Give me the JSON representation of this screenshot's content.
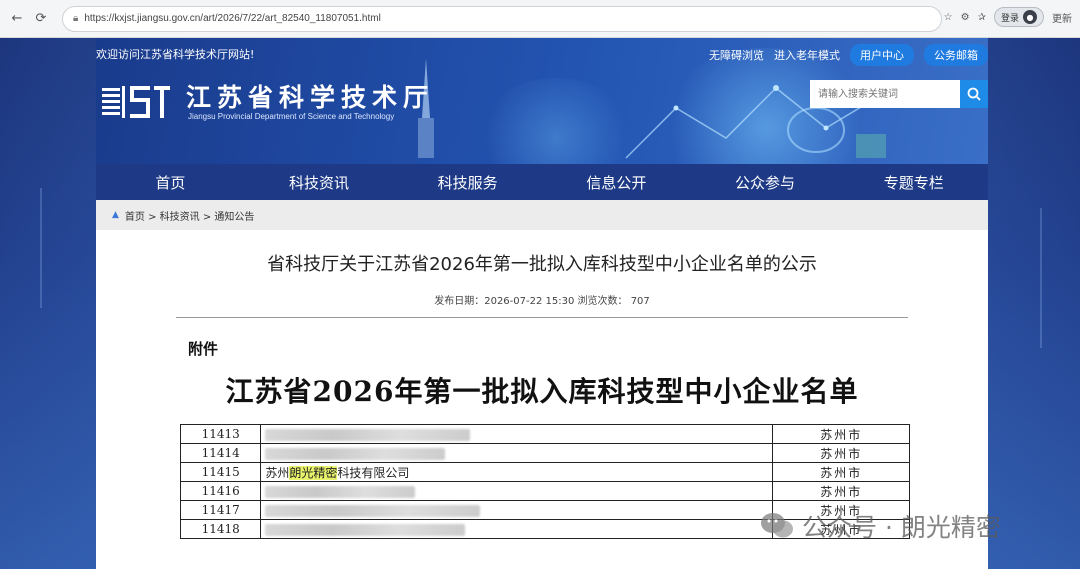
{
  "browser": {
    "url": "https://kxjst.jiangsu.gov.cn/art/2026/7/22/art_82540_11807051.html",
    "profile_label": "登录",
    "update_label": "更新"
  },
  "site": {
    "welcome": "欢迎访问江苏省科学技术厅网站!",
    "top_links": [
      "无障碍浏览",
      "进入老年模式"
    ],
    "top_buttons": [
      "用户中心",
      "公务邮箱"
    ],
    "title": "江苏省科学技术厅",
    "subtitle": "Jiangsu Provincial Department of Science and Technology",
    "logo_text": "JST",
    "search_placeholder": "请输入搜索关键词"
  },
  "nav": [
    "首页",
    "科技资讯",
    "科技服务",
    "信息公开",
    "公众参与",
    "专题专栏"
  ],
  "breadcrumb": "首页 > 科技资讯 > 通知公告",
  "article": {
    "title": "省科技厅关于江苏省2026年第一批拟入库科技型中小企业名单的公示",
    "meta": "发布日期：2026-07-22 15:30   浏览次数：  707",
    "attachment_label": "附件",
    "doc_title": "江苏省2026年第一批拟入库科技型中小企业名单"
  },
  "table": {
    "rows": [
      {
        "no": "11413",
        "name": "",
        "city": "苏州市"
      },
      {
        "no": "11414",
        "name": "",
        "city": "苏州市"
      },
      {
        "no": "11415",
        "name_prefix": "苏州",
        "name_highlight": "朗光精密",
        "name_suffix": "科技有限公司",
        "city": "苏州市"
      },
      {
        "no": "11416",
        "name": "",
        "city": "苏州市"
      },
      {
        "no": "11417",
        "name": "",
        "city": "苏州市"
      },
      {
        "no": "11418",
        "name": "",
        "city": "苏州市"
      }
    ]
  },
  "watermark": "公众号 · 朗光精密",
  "colors": {
    "header_blue": "#2355b3",
    "nav_blue": "#1e3a86",
    "button_blue": "#1f7be0",
    "highlight": "#e8f26a"
  }
}
